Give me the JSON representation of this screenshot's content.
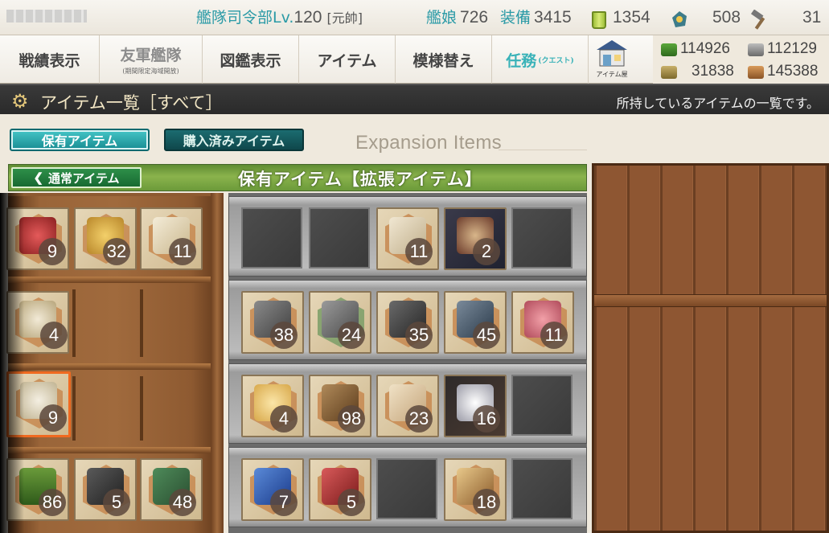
{
  "status": {
    "title": "艦隊司令部Lv.",
    "level": "120",
    "rank": "[元帥]",
    "ships_label": "艦娘",
    "ships": "726",
    "equip_label": "装備",
    "equip": "3415",
    "buckets": "1354",
    "dev_kits": "508",
    "screws": "31"
  },
  "nav": {
    "items": [
      {
        "label": "戦績表示",
        "sub": ""
      },
      {
        "label": "友軍艦隊",
        "sub": "(期間限定海域開放)"
      },
      {
        "label": "図鑑表示",
        "sub": ""
      },
      {
        "label": "アイテム",
        "sub": ""
      },
      {
        "label": "模様替え",
        "sub": ""
      },
      {
        "label": "任務",
        "sub": "(クエスト)"
      }
    ],
    "shop_label": "アイテム屋"
  },
  "resources": {
    "fuel": "114926",
    "steel": "112129",
    "ammo": "31838",
    "bauxite": "145388"
  },
  "titlebar": {
    "title": "アイテム一覧［すべて］",
    "description": "所持しているアイテムの一覧です。"
  },
  "tabs": {
    "owned": "保有アイテム",
    "purchased": "購入済みアイテム",
    "section_label": "Expansion Items"
  },
  "header": {
    "back": "通常アイテム",
    "title": "保有アイテム【拡張アイテム】"
  },
  "left_items": {
    "r1": [
      "9",
      "32",
      "11"
    ],
    "r2": [
      "4"
    ],
    "r3": [
      "9"
    ],
    "r4": [
      "86",
      "5",
      "48"
    ]
  },
  "grid_items": {
    "r1": [
      "11",
      "2"
    ],
    "r2": [
      "38",
      "24",
      "35",
      "45",
      "11"
    ],
    "r3": [
      "4",
      "98",
      "23",
      "16"
    ],
    "r4": [
      "7",
      "5",
      "18"
    ]
  },
  "colors": {
    "accent_teal": "#2a9aa6",
    "tab_active": "#178c92",
    "selected_border": "#f06a20",
    "header_green": "#6b9a3a"
  }
}
